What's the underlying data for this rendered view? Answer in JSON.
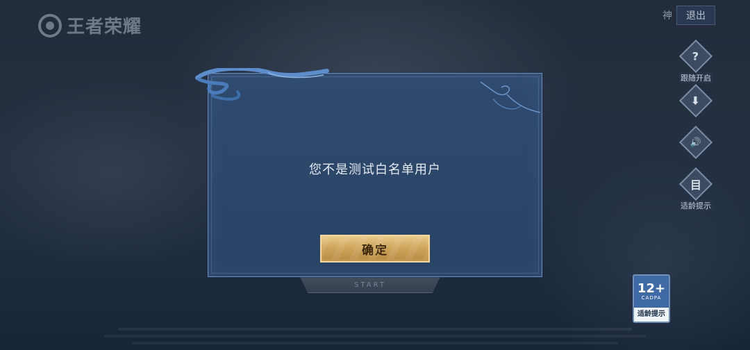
{
  "colors": {
    "modal_bg": "#2c4668",
    "modal_border": "#6f8eb8",
    "button_gold": "#cfa65d",
    "age_blue": "#3f6aa5"
  },
  "header": {
    "logo_text": "王者荣耀",
    "top_right_small": "神",
    "logout_label": "退出"
  },
  "side_buttons": [
    {
      "icon": "question-icon",
      "glyph": "?",
      "label": "跟随开启"
    },
    {
      "icon": "download-icon",
      "glyph": "⬇",
      "label": ""
    },
    {
      "icon": "speaker-icon",
      "glyph": "🔊",
      "label": ""
    },
    {
      "icon": "notice-icon",
      "glyph": "目",
      "label": "适龄提示"
    }
  ],
  "age_badge": {
    "rating": "12+",
    "org": "CADPA",
    "label": "适龄提示"
  },
  "start_button": {
    "subtext": "START"
  },
  "modal": {
    "message": "您不是测试白名单用户",
    "confirm_label": "确定"
  }
}
